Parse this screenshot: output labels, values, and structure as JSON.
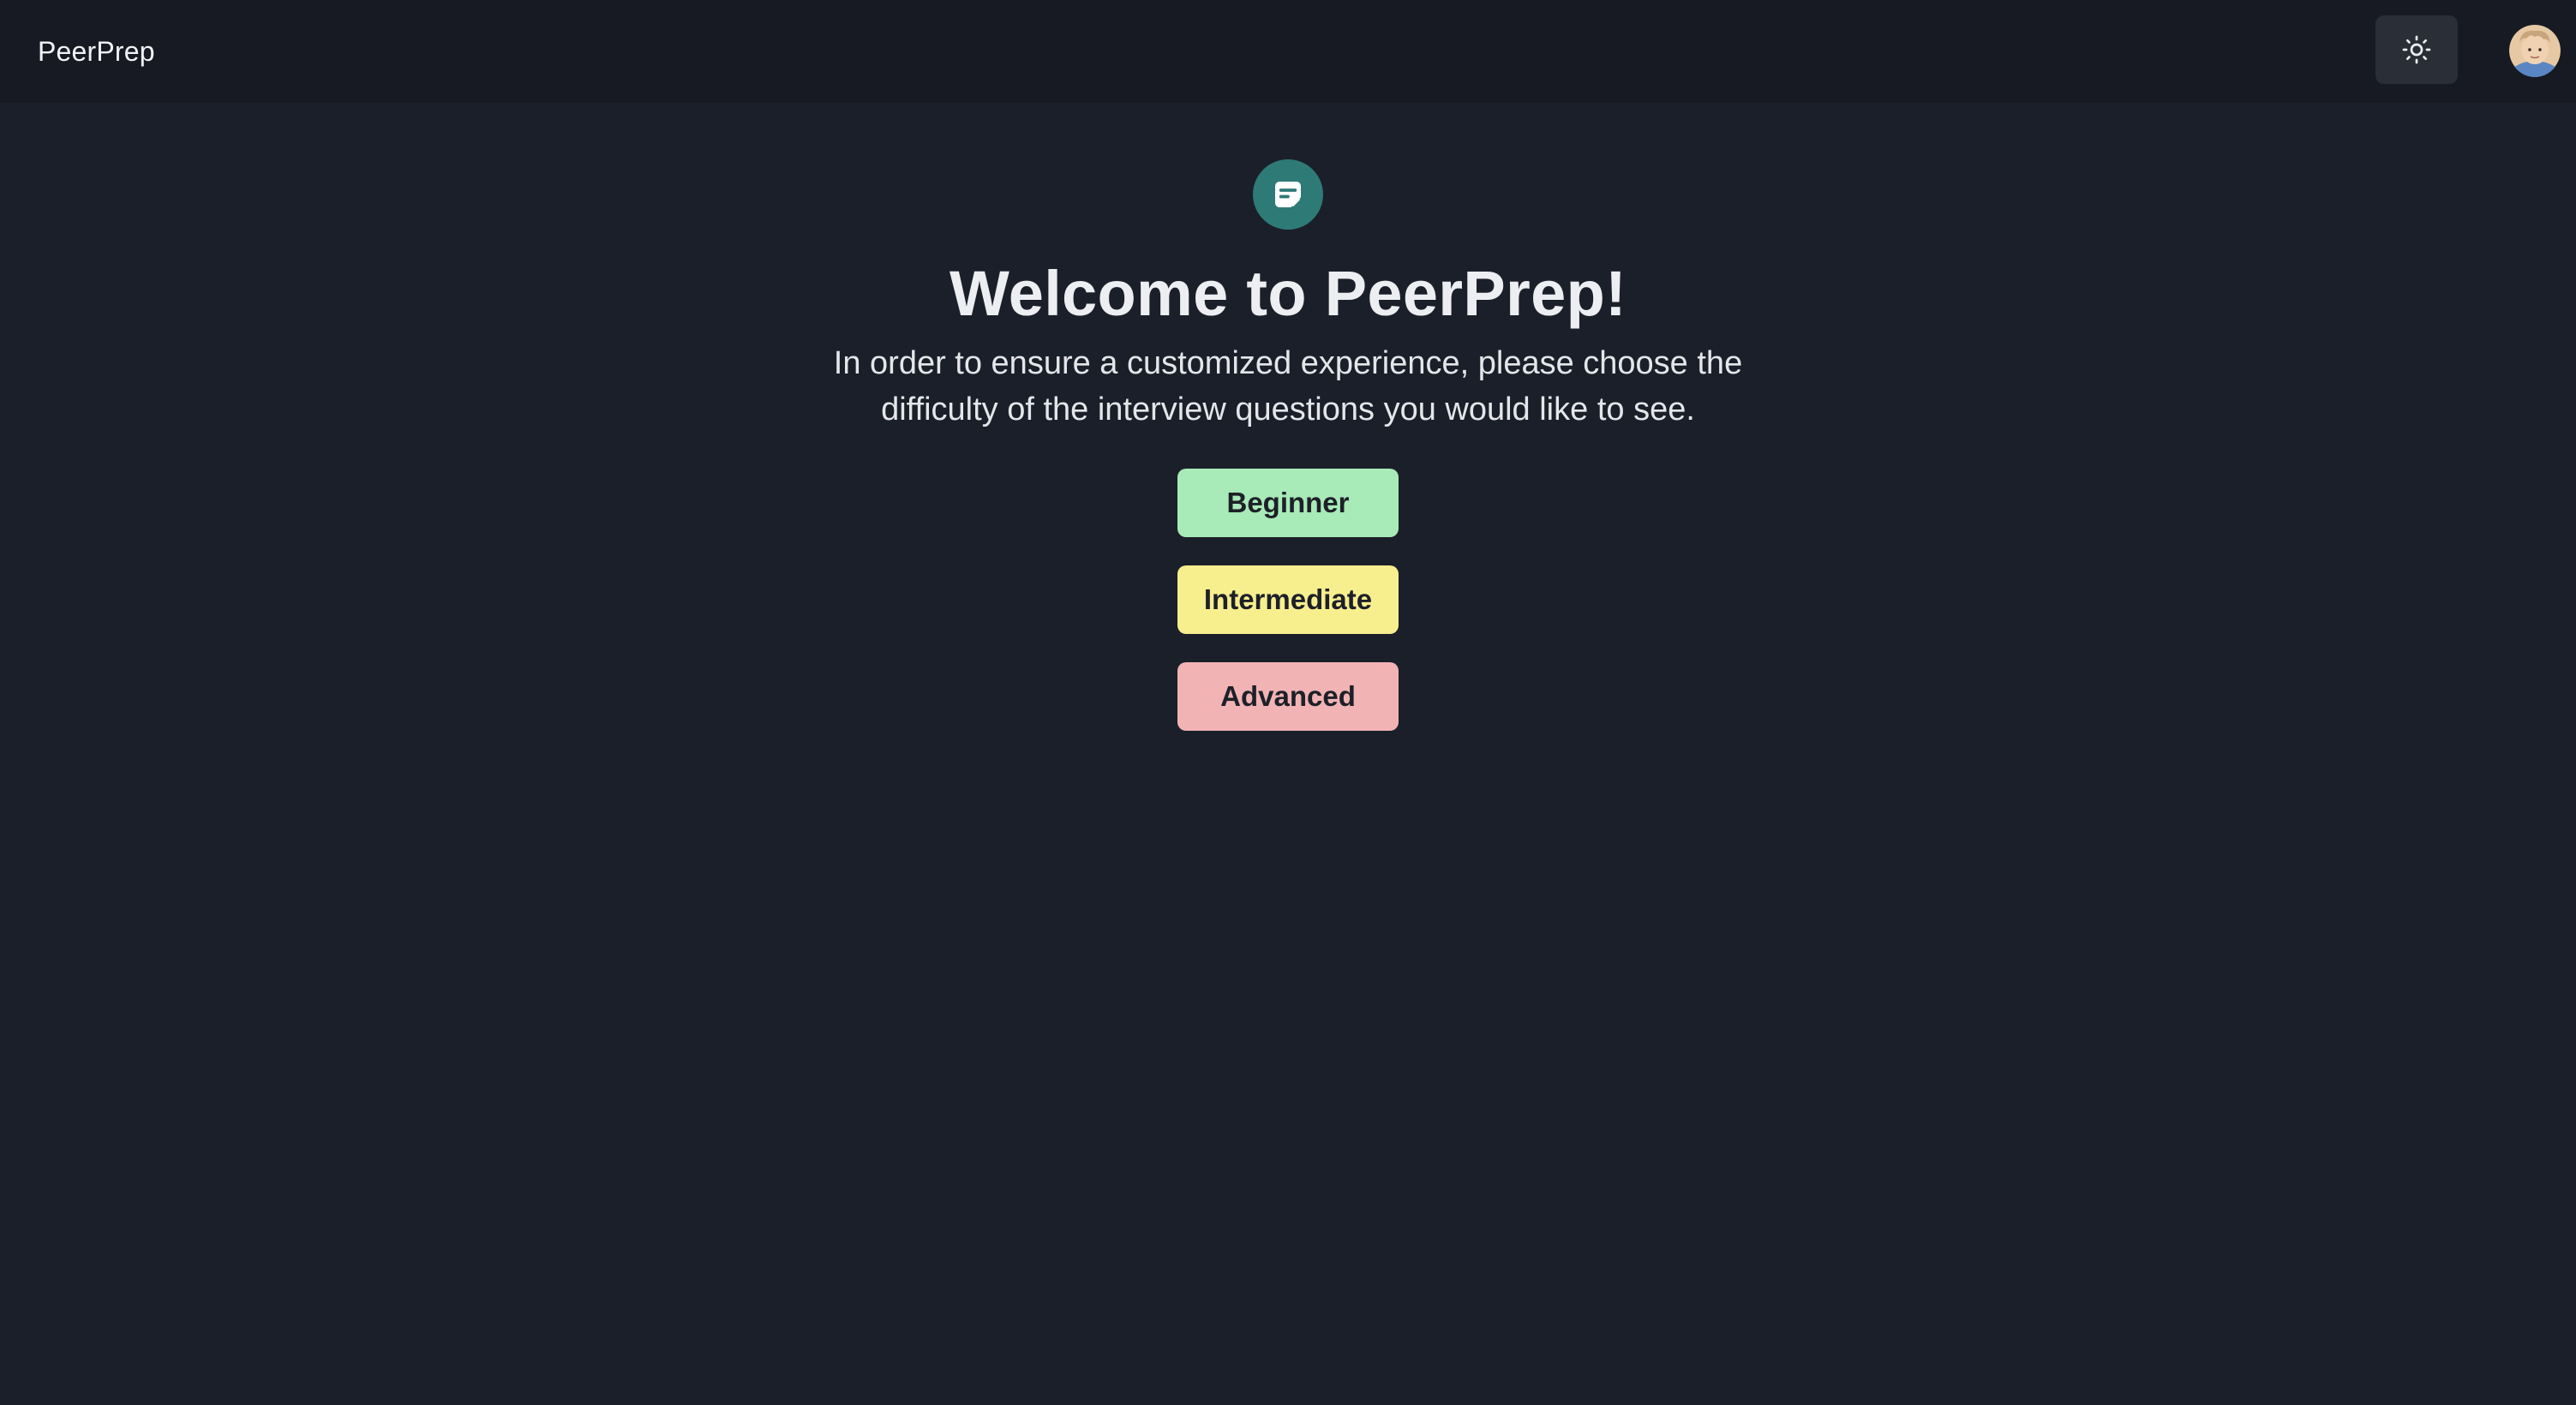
{
  "header": {
    "brand": "PeerPrep",
    "theme_toggle_icon": "sun-icon",
    "avatar_icon": "user-avatar"
  },
  "main": {
    "logo_icon": "note-edit-icon",
    "title": "Welcome to PeerPrep!",
    "subtitle": "In order to ensure a customized experience, please choose the difficulty of the interview questions you would like to see.",
    "buttons": [
      {
        "label": "Beginner",
        "color": "#a8eab8"
      },
      {
        "label": "Intermediate",
        "color": "#f7ee8e"
      },
      {
        "label": "Advanced",
        "color": "#f2b3b5"
      }
    ]
  },
  "colors": {
    "background": "#1b1f29",
    "header_bg": "#171a22",
    "accent_teal": "#2e7a77"
  }
}
